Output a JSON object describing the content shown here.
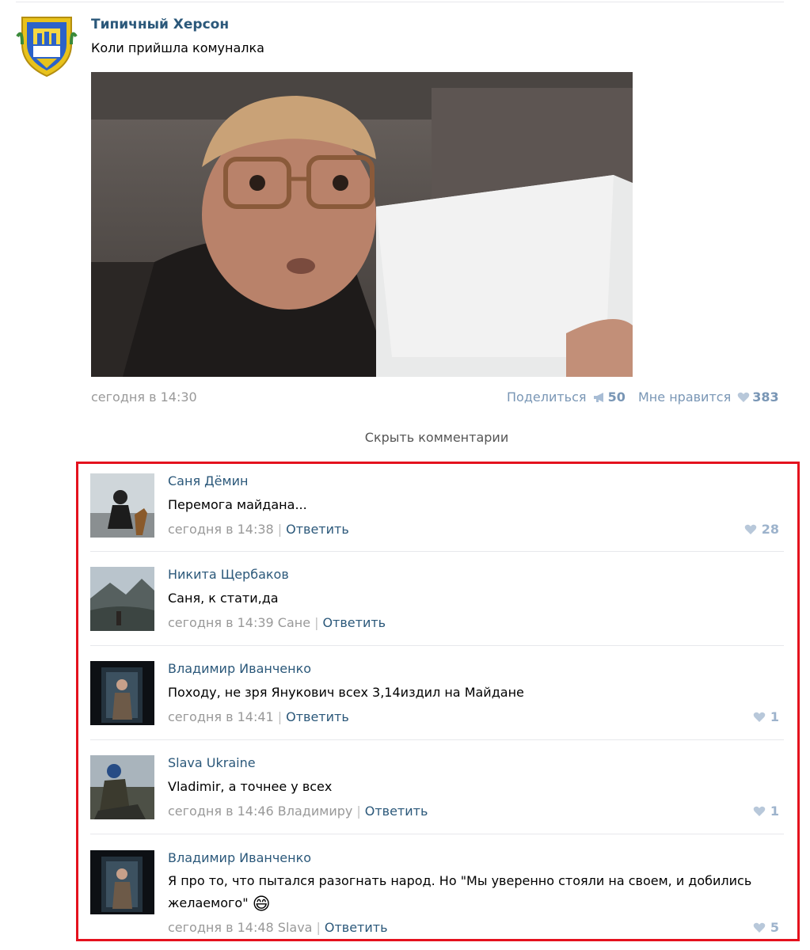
{
  "post": {
    "group_name": "Типичный Херсон",
    "text": "Коли прийшла комуналка",
    "date": "сегодня в 14:30",
    "share_label": "Поделиться",
    "share_count": "50",
    "like_label": "Мне нравится",
    "like_count": "383",
    "share_icon": "megaphone-icon",
    "like_icon": "heart-icon"
  },
  "hide_comments_label": "Скрыть комментарии",
  "comments": [
    {
      "author": "Саня Дёмин",
      "text": "Перемога майдана...",
      "date": "сегодня в 14:38",
      "reply": "Ответить",
      "likes": "28"
    },
    {
      "author": "Никита Щербаков",
      "text": "Саня, к стати,да",
      "date": "сегодня в 14:39 Сане",
      "reply": "Ответить",
      "likes": ""
    },
    {
      "author": "Владимир Иванченко",
      "text": "Походу, не зря Янукович всех 3,14издил на Майдане",
      "date": "сегодня в 14:41",
      "reply": "Ответить",
      "likes": "1"
    },
    {
      "author": "Slava Ukraine",
      "text": "Vladimir, а точнее у всех",
      "date": "сегодня в 14:46 Владимиру",
      "reply": "Ответить",
      "likes": "1"
    },
    {
      "author": "Владимир Иванченко",
      "text": "Я про то, что пытался разогнать народ. Но \"Мы уверенно стояли на своем, и добились желаемого\"",
      "emoji": "😄",
      "date": "сегодня в 14:48 Slava",
      "reply": "Ответить",
      "likes": "5"
    }
  ],
  "colors": {
    "link": "#2b587a",
    "muted": "#999999",
    "highlight_border": "#e4121e",
    "like": "#9db3cc"
  }
}
